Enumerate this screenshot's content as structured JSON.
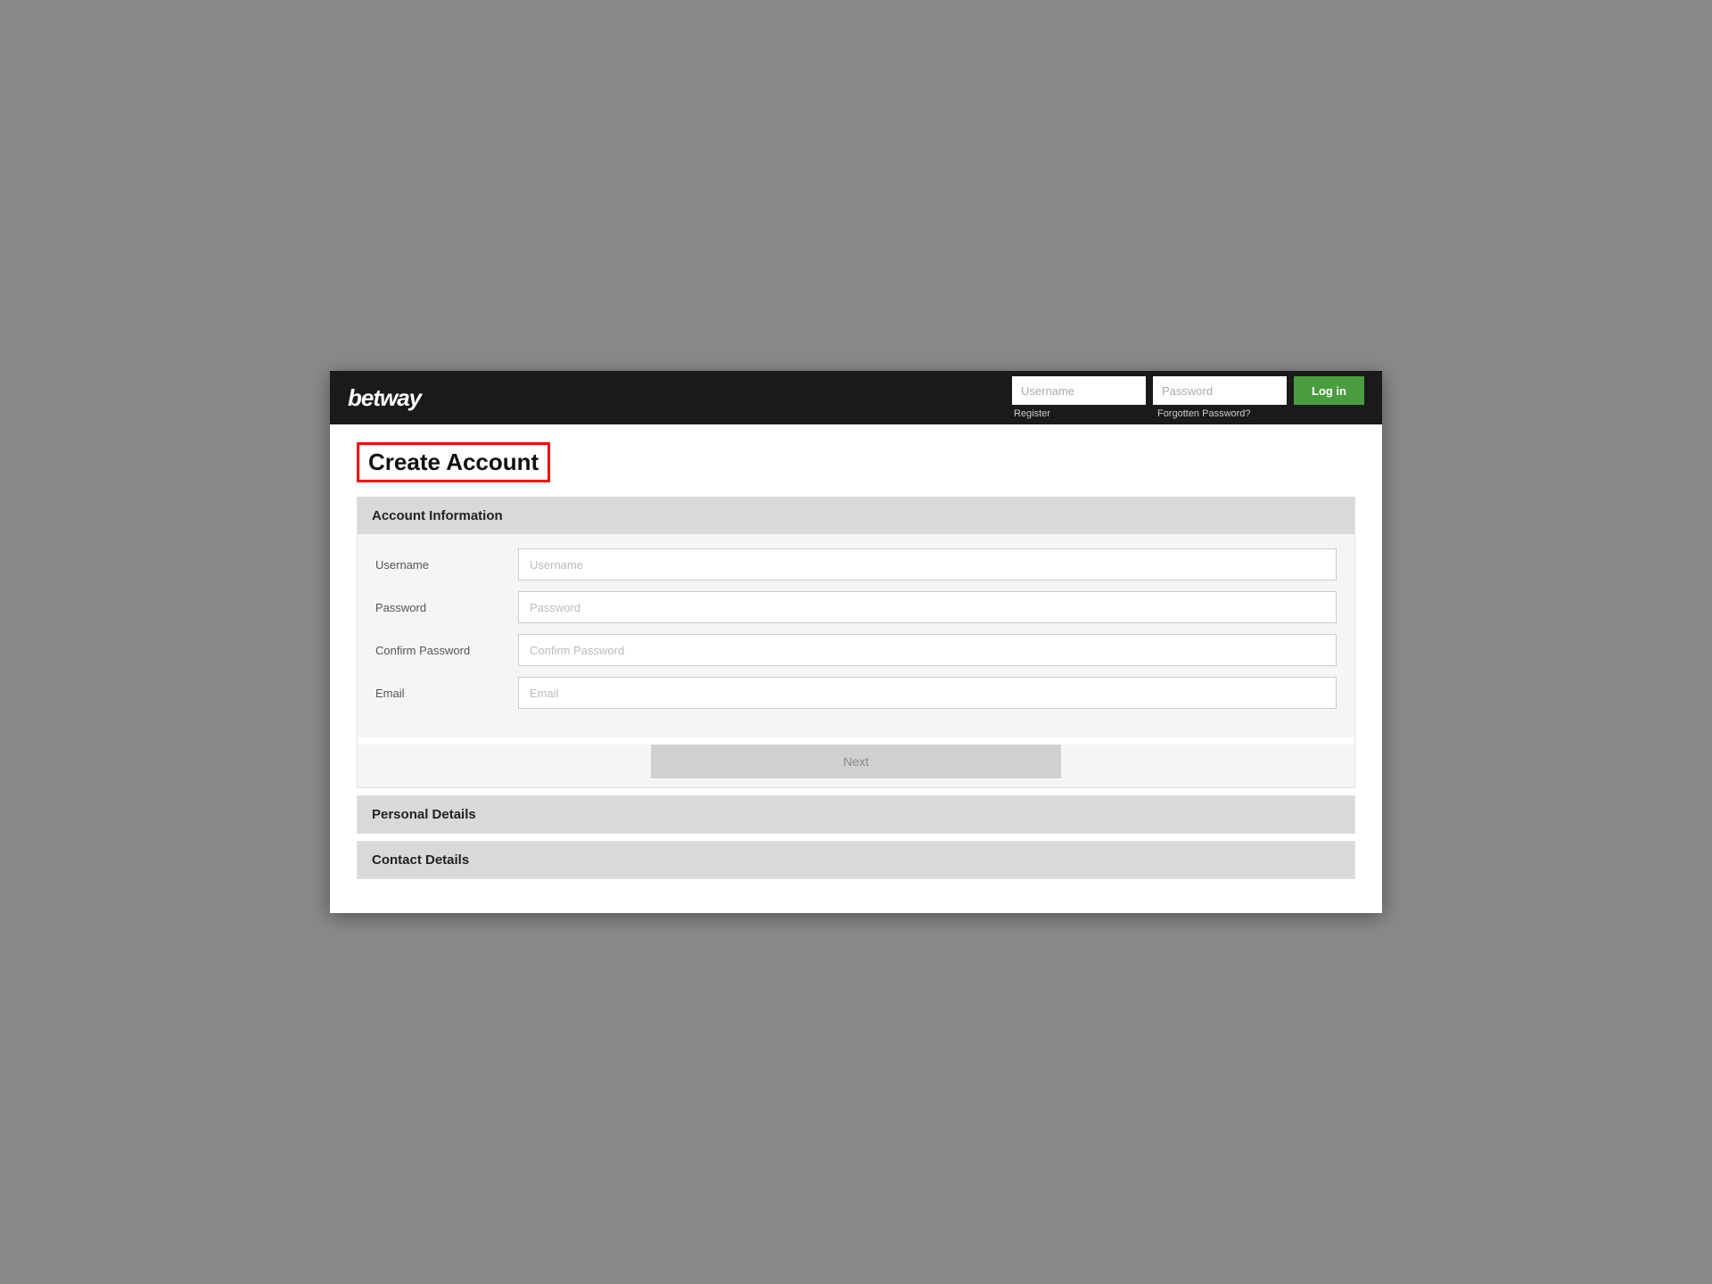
{
  "logo": {
    "text": "betway"
  },
  "navbar": {
    "username_placeholder": "Username",
    "password_placeholder": "Password",
    "login_label": "Log in",
    "register_label": "Register",
    "forgotten_password_label": "Forgotten Password?"
  },
  "page": {
    "title": "Create Account"
  },
  "account_information": {
    "section_title": "Account Information",
    "fields": [
      {
        "label": "Username",
        "placeholder": "Username",
        "type": "text"
      },
      {
        "label": "Password",
        "placeholder": "Password",
        "type": "password"
      },
      {
        "label": "Confirm Password",
        "placeholder": "Confirm Password",
        "type": "password"
      },
      {
        "label": "Email",
        "placeholder": "Email",
        "type": "email"
      }
    ],
    "next_button": "Next"
  },
  "personal_details": {
    "section_title": "Personal Details"
  },
  "contact_details": {
    "section_title": "Contact Details"
  }
}
